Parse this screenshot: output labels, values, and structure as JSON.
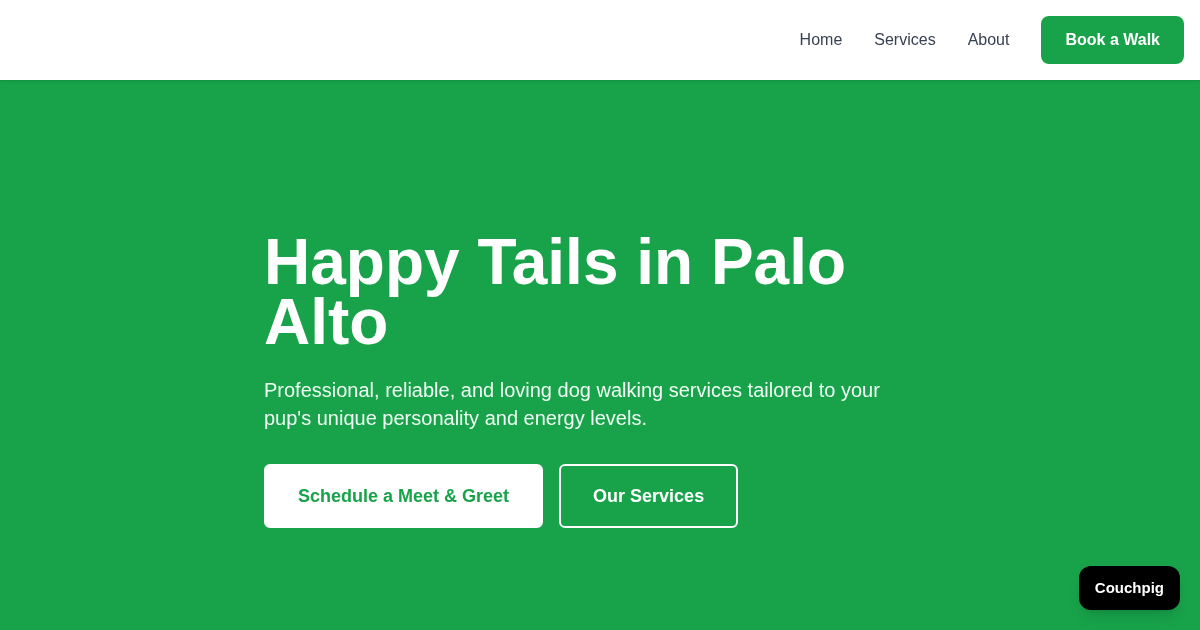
{
  "nav": {
    "links": [
      "Home",
      "Services",
      "About"
    ],
    "cta": "Book a Walk"
  },
  "hero": {
    "title": "Happy Tails in Palo Alto",
    "subtitle": "Professional, reliable, and loving dog walking services tailored to your pup's unique personality and energy levels.",
    "buttons": [
      {
        "label": "Schedule a Meet & Greet",
        "kind": "primary"
      },
      {
        "label": "Our Services",
        "kind": "outline"
      }
    ]
  },
  "badge": {
    "label": "Couchpig"
  }
}
